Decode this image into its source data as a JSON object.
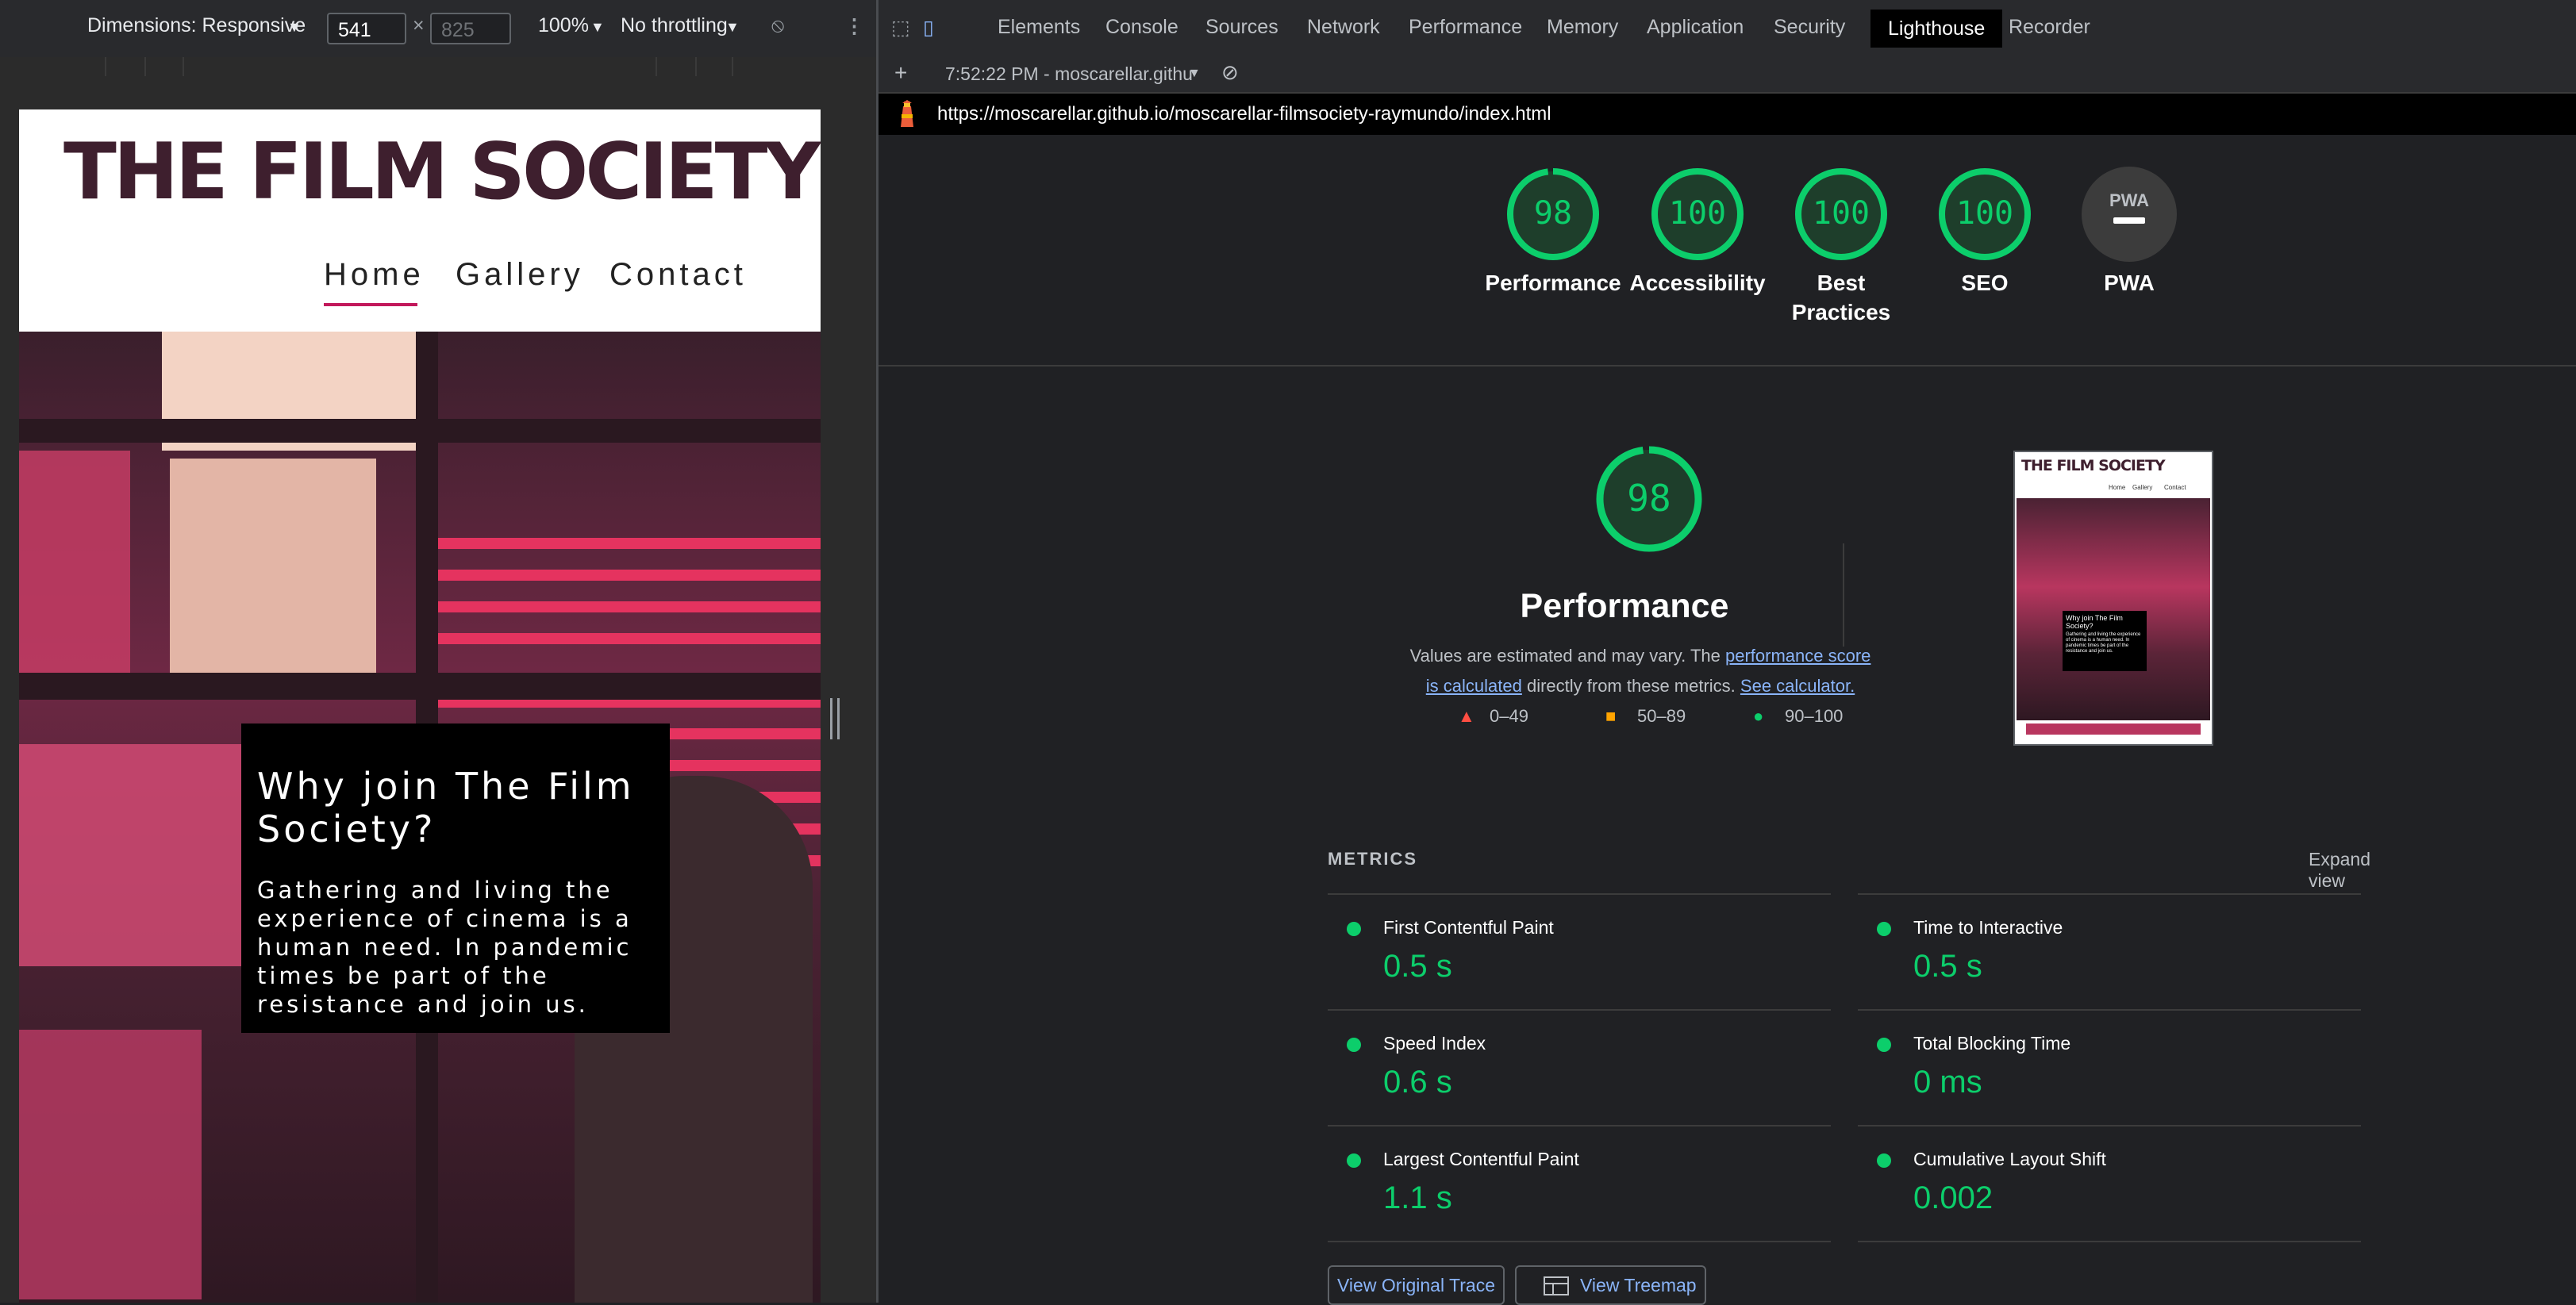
{
  "device_toolbar": {
    "dimensions_label": "Dimensions: Responsive",
    "width_value": "541",
    "height_placeholder": "825",
    "times": "×",
    "zoom": "100%",
    "throttling": "No throttling"
  },
  "preview": {
    "logo": "THE FILM SOCIETY",
    "nav": [
      "Home",
      "Gallery",
      "Contact"
    ],
    "hero_title": "Why join The Film Society?",
    "hero_body": "Gathering and living the experience of cinema is a human need. In pandemic times be part of the resistance and join us."
  },
  "devtools": {
    "tabs": [
      "Elements",
      "Console",
      "Sources",
      "Network",
      "Performance",
      "Memory",
      "Application",
      "Security",
      "Lighthouse",
      "Recorder"
    ],
    "active_tab": "Lighthouse",
    "report_selector": "7:52:22 PM - moscarellar.githu",
    "url": "https://moscarellar.github.io/moscarellar-filmsociety-raymundo/index.html"
  },
  "scores": [
    {
      "label": "Performance",
      "value": "98",
      "score": 0.98
    },
    {
      "label": "Accessibility",
      "value": "100",
      "score": 1.0
    },
    {
      "label": "Best Practices",
      "value": "100",
      "score": 1.0
    },
    {
      "label": "SEO",
      "value": "100",
      "score": 1.0
    },
    {
      "label": "PWA",
      "value": "PWA",
      "score": null
    }
  ],
  "performance": {
    "score": "98",
    "title": "Performance",
    "desc_prefix": "Values are estimated and may vary. The ",
    "desc_link1": "performance score is calculated",
    "desc_middle": " directly from these metrics. ",
    "desc_link2": "See calculator.",
    "legend": [
      "0–49",
      "50–89",
      "90–100"
    ]
  },
  "metrics": {
    "title": "METRICS",
    "expand": "Expand view",
    "items": [
      {
        "name": "First Contentful Paint",
        "value": "0.5 s"
      },
      {
        "name": "Time to Interactive",
        "value": "0.5 s"
      },
      {
        "name": "Speed Index",
        "value": "0.6 s"
      },
      {
        "name": "Total Blocking Time",
        "value": "0 ms"
      },
      {
        "name": "Largest Contentful Paint",
        "value": "1.1 s"
      },
      {
        "name": "Cumulative Layout Shift",
        "value": "0.002"
      }
    ]
  },
  "buttons": {
    "view_trace": "View Original Trace",
    "view_treemap": "View Treemap"
  },
  "thumbnail": {
    "logo": "THE FILM SOCIETY",
    "nav": [
      "Home",
      "Gallery",
      "Contact"
    ],
    "card_title": "Why join The Film Society?",
    "card_body": "Gathering and living the experience of cinema is a human need. In pandemic times be part of the resistance and join us."
  },
  "colors": {
    "pass": "#0cce6b",
    "average": "#ffa400",
    "fail": "#ff4e42",
    "link": "#8ab4f8",
    "accent": "#c2185b"
  }
}
